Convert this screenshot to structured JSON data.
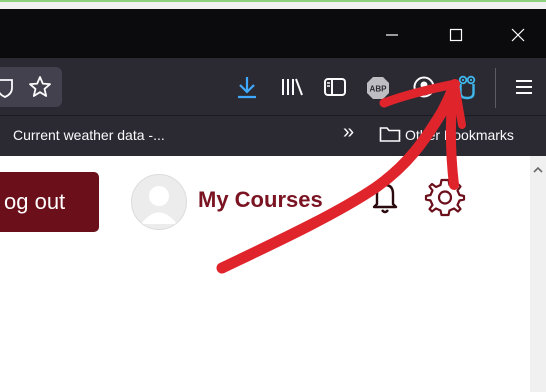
{
  "window": {
    "minimize_icon": "minimize-icon",
    "maximize_icon": "maximize-icon",
    "close_icon": "close-icon"
  },
  "toolbar": {
    "icons": [
      "reader-shield-icon",
      "star-icon",
      "download-icon",
      "library-icon",
      "sidebar-icon",
      "adblock-icon",
      "account-icon",
      "extension-owl-icon",
      "menu-icon"
    ],
    "abp_label": "ABP"
  },
  "bookmarks": {
    "item": "Current weather data -...",
    "overflow_label": "»",
    "other": "Other Bookmarks"
  },
  "page": {
    "logout_label": "og out",
    "my_courses_label": "My Courses"
  },
  "colors": {
    "accent": "#6b0f1a",
    "brand_text": "#7a1322",
    "annotation": "#e0242c",
    "toolbar_bg": "#2b2a33",
    "titlebar_bg": "#0b0b0d"
  }
}
